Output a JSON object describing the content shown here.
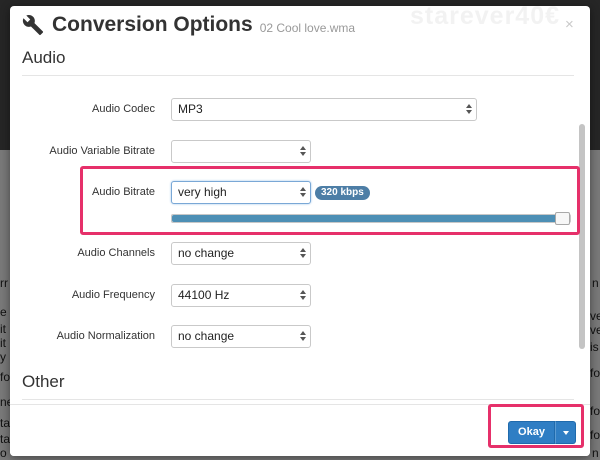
{
  "watermark": "starever40€",
  "background": {
    "left_fragments": [
      "rr",
      "e",
      "it",
      "it",
      "y",
      "fo",
      "ne",
      "ta",
      "ta",
      "o"
    ],
    "right_fragments": [
      "n",
      "ve",
      "ve",
      "is",
      "fo",
      "fo",
      "fo",
      "n"
    ]
  },
  "dialog": {
    "title": "Conversion Options",
    "subtitle": "02 Cool love.wma",
    "close_icon": "×"
  },
  "sections": {
    "audio": "Audio",
    "other": "Other"
  },
  "fields": {
    "codec": {
      "label": "Audio Codec",
      "value": "MP3"
    },
    "vbr": {
      "label": "Audio Variable Bitrate",
      "value": ""
    },
    "bitrate": {
      "label": "Audio Bitrate",
      "value": "very high",
      "badge": "320 kbps",
      "slider_percent": 100
    },
    "channels": {
      "label": "Audio Channels",
      "value": "no change"
    },
    "frequency": {
      "label": "Audio Frequency",
      "value": "44100 Hz"
    },
    "normalization": {
      "label": "Audio Normalization",
      "value": "no change"
    }
  },
  "footer": {
    "okay_label": "Okay"
  },
  "colors": {
    "highlight": "#e6306a",
    "primary": "#2f7ec4",
    "slider_fill": "#4d8fb5",
    "badge": "#4d7ea6"
  },
  "icons": {
    "header": "wrench-icon",
    "close": "close-icon",
    "select_arrows": "sort-arrows-icon",
    "dropdown": "caret-down-icon"
  }
}
